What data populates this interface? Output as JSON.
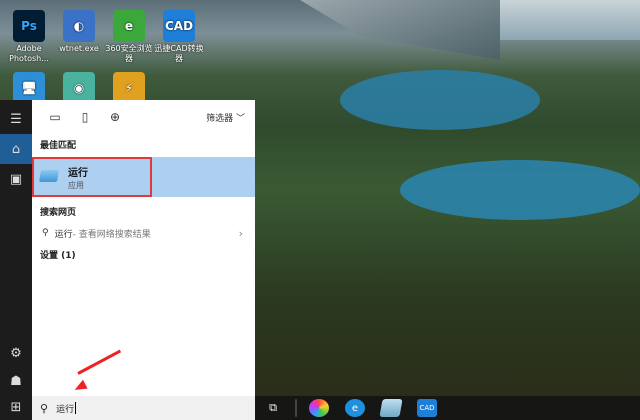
{
  "desktop": {
    "icons": [
      {
        "label": "Adobe Photosh...",
        "glyph": "Ps",
        "bg": "#001d34",
        "fg": "#31a8ff"
      },
      {
        "label": "wtnet.exe",
        "glyph": "◐",
        "bg": "#3a72c8",
        "fg": "#fff"
      },
      {
        "label": "360安全浏览器",
        "glyph": "e",
        "bg": "#3aa83a",
        "fg": "#fff"
      },
      {
        "label": "迅捷CAD转换器",
        "glyph": "CAD",
        "bg": "#1e7fd8",
        "fg": "#fff"
      },
      {
        "label": "",
        "glyph": "🖥",
        "bg": "#2d8fd8",
        "fg": "#fff"
      },
      {
        "label": "",
        "glyph": "◉",
        "bg": "#4ab3a0",
        "fg": "#fff"
      },
      {
        "label": "",
        "glyph": "⚡",
        "bg": "#e0a020",
        "fg": "#fff"
      }
    ]
  },
  "start": {
    "filter_label": "筛选器",
    "best_match_header": "最佳匹配",
    "best_match": {
      "title": "运行",
      "subtitle": "应用"
    },
    "web_header": "搜索网页",
    "web_item": {
      "query": "运行",
      "suffix": " - 查看网络搜索结果"
    },
    "settings_header": "设置 (1)",
    "search_value": "运行"
  },
  "colors": {
    "highlight": "#aed0f0",
    "annotation": "#e23a3a"
  }
}
